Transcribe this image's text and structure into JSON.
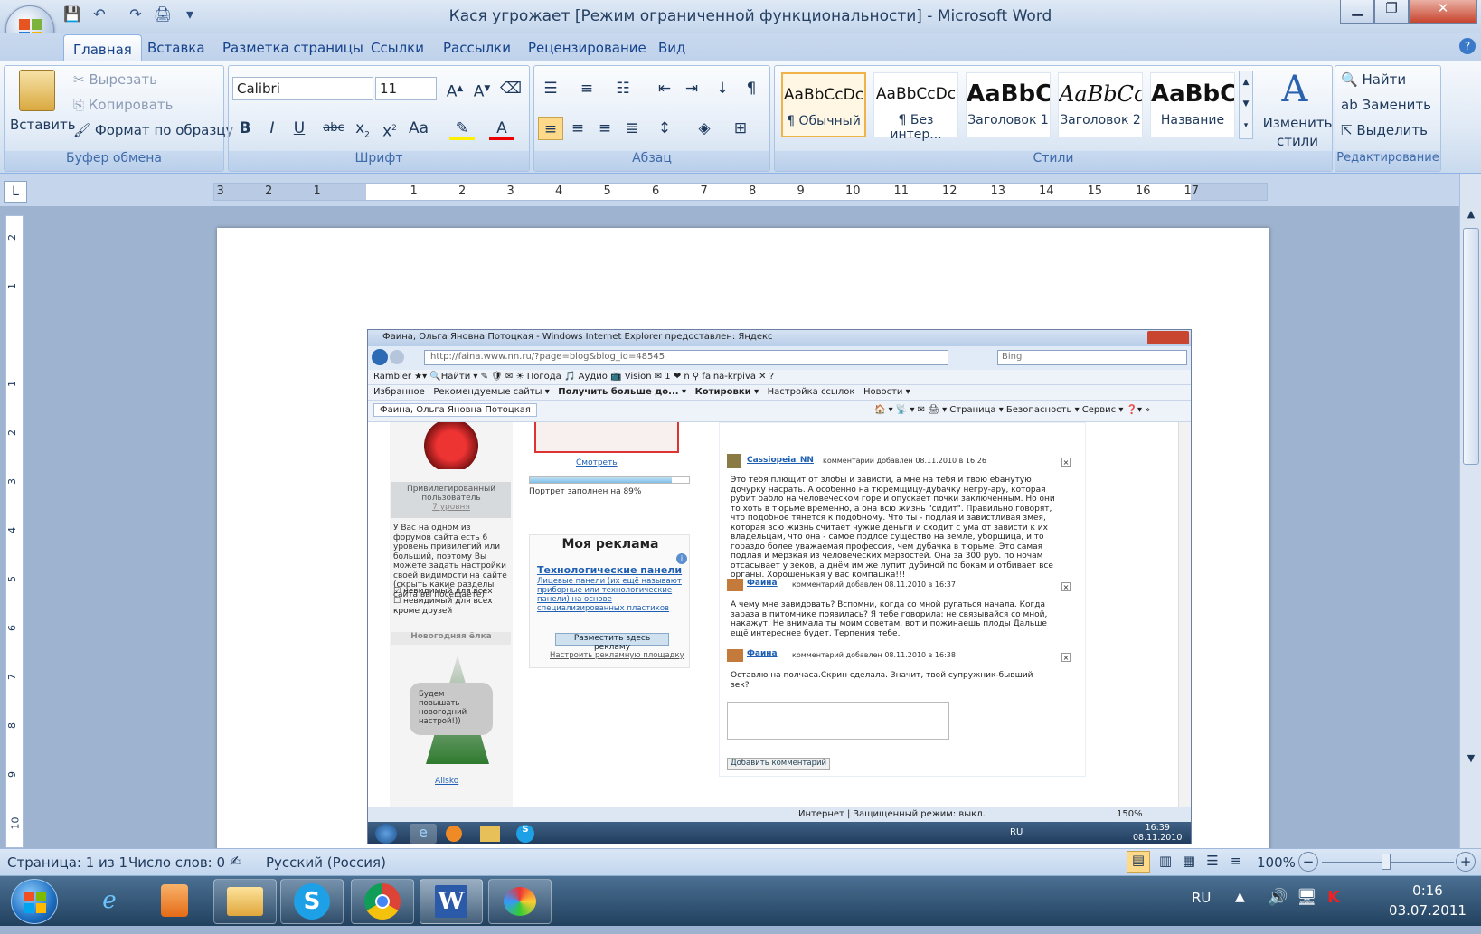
{
  "window": {
    "title": "Кася угрожает [Режим ограниченной функциональности] - Microsoft Word"
  },
  "qat": {
    "save": "💾",
    "undo": "↶",
    "redo": "↷",
    "print": "🖨",
    "more": "▾"
  },
  "tabs": [
    "Главная",
    "Вставка",
    "Разметка страницы",
    "Ссылки",
    "Рассылки",
    "Рецензирование",
    "Вид"
  ],
  "clipboard": {
    "paste": "Вставить",
    "cut": "Вырезать",
    "copy": "Копировать",
    "format": "Формат по образцу",
    "label": "Буфер обмена"
  },
  "font": {
    "name": "Calibri",
    "size": "11",
    "label": "Шрифт"
  },
  "paragraph": {
    "label": "Абзац"
  },
  "styles": {
    "items": [
      {
        "preview": "AaBbCcDc",
        "name": "¶ Обычный"
      },
      {
        "preview": "AaBbCcDc",
        "name": "¶ Без интер..."
      },
      {
        "preview": "AaBbC",
        "name": "Заголовок 1"
      },
      {
        "preview": "AaBbCc",
        "name": "Заголовок 2"
      },
      {
        "preview": "AaBbC",
        "name": "Название"
      }
    ],
    "change": "Изменить стили",
    "label": "Стили"
  },
  "editing": {
    "find": "Найти",
    "replace": "Заменить",
    "select": "Выделить",
    "label": "Редактирование"
  },
  "ruler": {
    "numbers": [
      "3",
      "2",
      "1",
      "1",
      "2",
      "3",
      "4",
      "5",
      "6",
      "7",
      "8",
      "9",
      "10",
      "11",
      "12",
      "13",
      "14",
      "15",
      "16",
      "17"
    ]
  },
  "vruler": {
    "numbers": [
      "2",
      "1",
      "1",
      "2",
      "3",
      "4",
      "5",
      "6",
      "7",
      "8",
      "9",
      "10"
    ]
  },
  "ie": {
    "title": "Фаина, Ольга Яновна Потоцкая - Windows Internet Explorer предоставлен: Яндекс",
    "url": "http://faina.www.nn.ru/?page=blog&blog_id=48545",
    "search": "Bing",
    "toolbar1": "Rambler ★▾   🔍Найти ▾ ✎ 🛡 ✉   ☀ Погода  🎵 Аудио  📺 Vision  ✉ 1  ❤ n  ⚲ faina-krpiva   ✕ ?",
    "favorites": [
      "Избранное",
      "Рекомендуемые сайты ▾",
      "Получить больше до... ▾",
      "Котировки ▾",
      "Настройка ссылок",
      "Новости ▾"
    ],
    "tab": "Фаина, Ольга Яновна Потоцкая",
    "cmdbar": "🏠 ▾  📡 ▾  ✉  🖨 ▾  Страница ▾  Безопасность ▾  Сервис ▾  ❓▾  »",
    "left": {
      "rank": "Привилегированный пользователь",
      "level": "7 уровня",
      "note": "У Вас на одном из форумов сайта есть 6 уровень привилегий или больший, поэтому Вы можете задать настройки своей видимости на сайте (скрыть какие разделы сайта вы посещаете):",
      "opt1": "невидимый для всех",
      "opt2": "невидимый для всех кроме друзей",
      "tree_title": "Новогодняя ёлка",
      "bubble": "Будем повышать новогодний настрой!))",
      "author": "Alisko"
    },
    "mid": {
      "watch": "Смотреть",
      "progress": "Портрет заполнен на 89%",
      "progress_value": 0.89,
      "ad_title": "Моя реклама",
      "ad_link": "Технологические панели",
      "ad_text": "Лицевые панели (их ещё называют приборные или технологические панели) на основе специализированных пластиков",
      "ad_button": "Разместить здесь рекламу",
      "ad_setup": "Настроить рекламную площадку"
    },
    "comments": [
      {
        "author": "Cassiopeia_NN",
        "meta": "комментарий добавлен 08.11.2010 в 16:26",
        "text": "Это тебя плющит от злобы и зависти, а мне на тебя и твою ебанутую дочурку насрать. А особенно на тюремщицу-дубачку негру-ару, которая рубит бабло на человеческом горе и опускает почки заключённым. Но они то хоть в тюрьме временно, а она всю жизнь \"сидит\". Правильно говорят, что подобное тянется к подобному. Что ты - подлая и завистливая змея, которая всю жизнь считает чужие деньги и сходит с ума от зависти к их владельцам, что она - самое подлое существо на земле, уборщица, и то гораздо более уважаемая профессия, чем дубачка в тюрьме. Это самая подлая и мерзкая из человеческих мерзостей. Она за 300 руб. по ночам отсасывает у зеков, а днём им же лупит дубиной по бокам и отбивает все органы. Хорошенькая у вас компашка!!!"
      },
      {
        "author": "Фаина",
        "meta": "комментарий добавлен 08.11.2010 в 16:37",
        "text": "А чему мне завидовать? Вспомни, когда со мной ругаться начала. Когда зараза в питомнике появилась? Я тебе говорила: не связывайся со мной, накажут. Не внимала ты моим советам, вот и пожинаешь плоды Дальше ещё интереснее будет. Терпения тебе."
      },
      {
        "author": "Фаина",
        "meta": "комментарий добавлен 08.11.2010 в 16:38",
        "text": "Оставлю на полчаса.Скрин сделала. Значит, твой супружник-бывший зек?"
      }
    ],
    "add_comment": "Добавить комментарий",
    "status": "Интернет | Защищенный режим: выкл.",
    "zoom": "150%",
    "tray_lang": "RU",
    "tray_time": "16:39",
    "tray_date": "08.11.2010"
  },
  "statusbar": {
    "page": "Страница: 1 из 1",
    "words": "Число слов: 0",
    "lang": "Русский (Россия)",
    "zoom": "100%"
  },
  "taskbar": {
    "lang": "RU",
    "time": "0:16",
    "date": "03.07.2011"
  }
}
